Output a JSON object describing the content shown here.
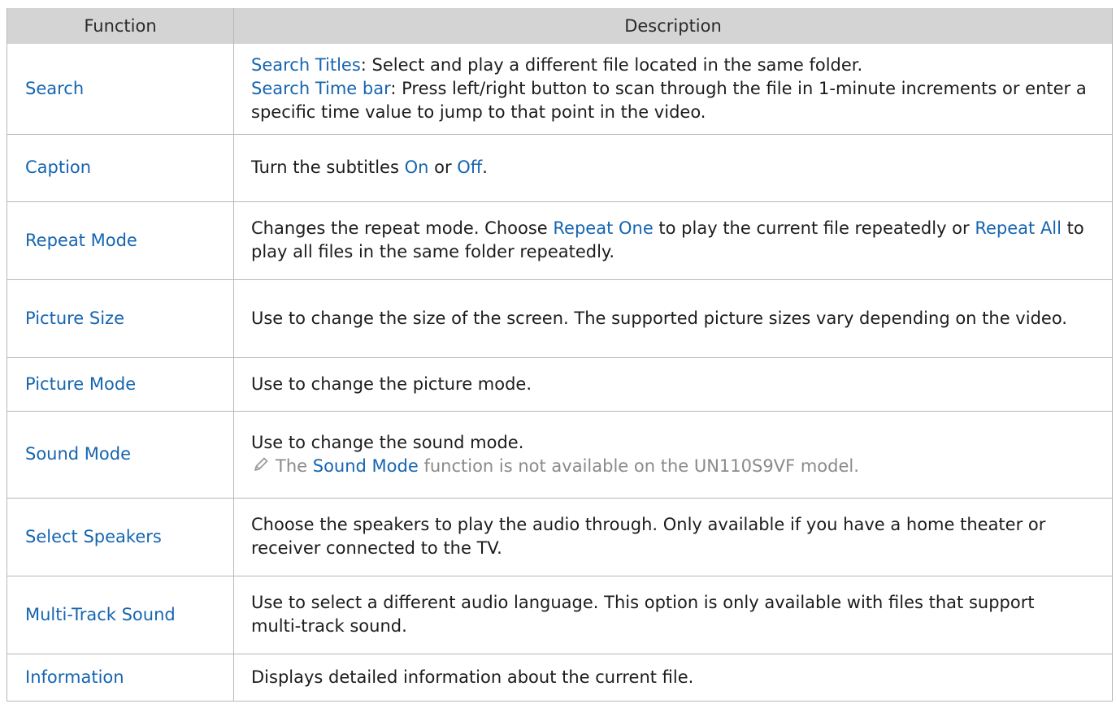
{
  "header": {
    "col_function": "Function",
    "col_description": "Description"
  },
  "rows": [
    {
      "function": "Search",
      "lines": [
        {
          "term": "Search Titles",
          "text": ": Select and play a different file located in the same folder."
        },
        {
          "term": "Search Time bar",
          "text": ": Press left/right button to scan through the file in 1-minute increments or enter a specific time value to jump to that point in the video."
        }
      ]
    },
    {
      "function": "Caption",
      "text_1": "Turn the subtitles ",
      "term_1": "On",
      "text_2": " or ",
      "term_2": "Off",
      "text_3": "."
    },
    {
      "function": "Repeat Mode",
      "text_1": "Changes the repeat mode. Choose ",
      "term_1": "Repeat One",
      "text_2": " to play the current file repeatedly or ",
      "term_2": "Repeat All",
      "text_3": " to play all files in the same folder repeatedly."
    },
    {
      "function": "Picture Size",
      "text": "Use to change the size of the screen. The supported picture sizes vary depending on the video."
    },
    {
      "function": "Picture Mode",
      "text": "Use to change the picture mode."
    },
    {
      "function": "Sound Mode",
      "text": "Use to change the sound mode.",
      "note": {
        "icon": "pencil-note-icon",
        "text_1": "The ",
        "term": "Sound Mode",
        "text_2": " function is not available on the UN110S9VF model."
      }
    },
    {
      "function": "Select Speakers",
      "text": "Choose the speakers to play the audio through. Only available if you have a home theater or receiver connected to the TV."
    },
    {
      "function": "Multi-Track Sound",
      "text": "Use to select a different audio language. This option is only available with files that support multi-track sound."
    },
    {
      "function": "Information",
      "text": "Displays detailed information about the current file."
    }
  ],
  "colors": {
    "accent": "#1665b0",
    "header_bg": "#d4d4d4",
    "note_text": "#8a8a8a",
    "border": "#b8b8b8"
  }
}
